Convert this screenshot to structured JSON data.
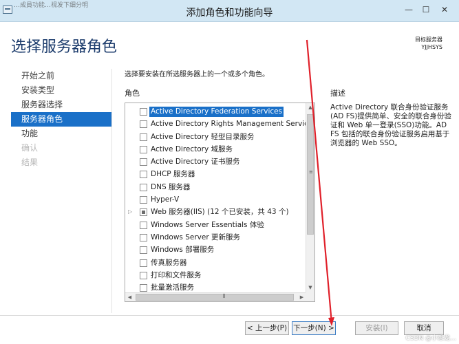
{
  "window": {
    "title_left": "…成員功能…视发下细分明",
    "title": "添加角色和功能向导",
    "min_glyph": "—",
    "max_glyph": "☐",
    "close_glyph": "✕"
  },
  "page": {
    "heading": "选择服务器角色",
    "destination_label": "目标服务器",
    "destination_value": "YJJHSYS",
    "intro": "选择要安装在所选服务器上的一个或多个角色。",
    "roles_header": "角色",
    "description_header": "描述",
    "description_text": "Active Directory 联合身份验证服务(AD FS)提供简单、安全的联合身份验证和 Web 单一登录(SSO)功能。AD FS 包括的联合身份验证服务启用基于浏览器的 Web SSO。"
  },
  "sidebar": {
    "items": [
      {
        "label": "开始之前",
        "state": "normal"
      },
      {
        "label": "安装类型",
        "state": "normal"
      },
      {
        "label": "服务器选择",
        "state": "normal"
      },
      {
        "label": "服务器角色",
        "state": "active"
      },
      {
        "label": "功能",
        "state": "normal"
      },
      {
        "label": "确认",
        "state": "disabled"
      },
      {
        "label": "结果",
        "state": "disabled"
      }
    ]
  },
  "roles": [
    {
      "label": "Active Directory Federation Services",
      "checked": false,
      "selected": true
    },
    {
      "label": "Active Directory Rights Management Services",
      "checked": false
    },
    {
      "label": "Active Directory 轻型目录服务",
      "checked": false
    },
    {
      "label": "Active Directory 域服务",
      "checked": false
    },
    {
      "label": "Active Directory 证书服务",
      "checked": false
    },
    {
      "label": "DHCP 服务器",
      "checked": false
    },
    {
      "label": "DNS 服务器",
      "checked": false
    },
    {
      "label": "Hyper-V",
      "checked": false
    },
    {
      "label": "Web 服务器(IIS) (12 个已安装，共 43 个)",
      "checked": "partial",
      "expandable": true
    },
    {
      "label": "Windows Server Essentials 体验",
      "checked": false
    },
    {
      "label": "Windows Server 更新服务",
      "checked": false
    },
    {
      "label": "Windows 部署服务",
      "checked": false
    },
    {
      "label": "传真服务器",
      "checked": false
    },
    {
      "label": "打印和文件服务",
      "checked": false
    },
    {
      "label": "批量激活服务",
      "checked": false
    }
  ],
  "buttons": {
    "prev": "< 上一步(P)",
    "next": "下一步(N) >",
    "install": "安装(I)",
    "cancel": "取消"
  },
  "watermark": "CSDN @小恐龙…",
  "colors": {
    "accent": "#1a70c8",
    "heading": "#1a3a6b",
    "annotation": "#e0202a"
  }
}
